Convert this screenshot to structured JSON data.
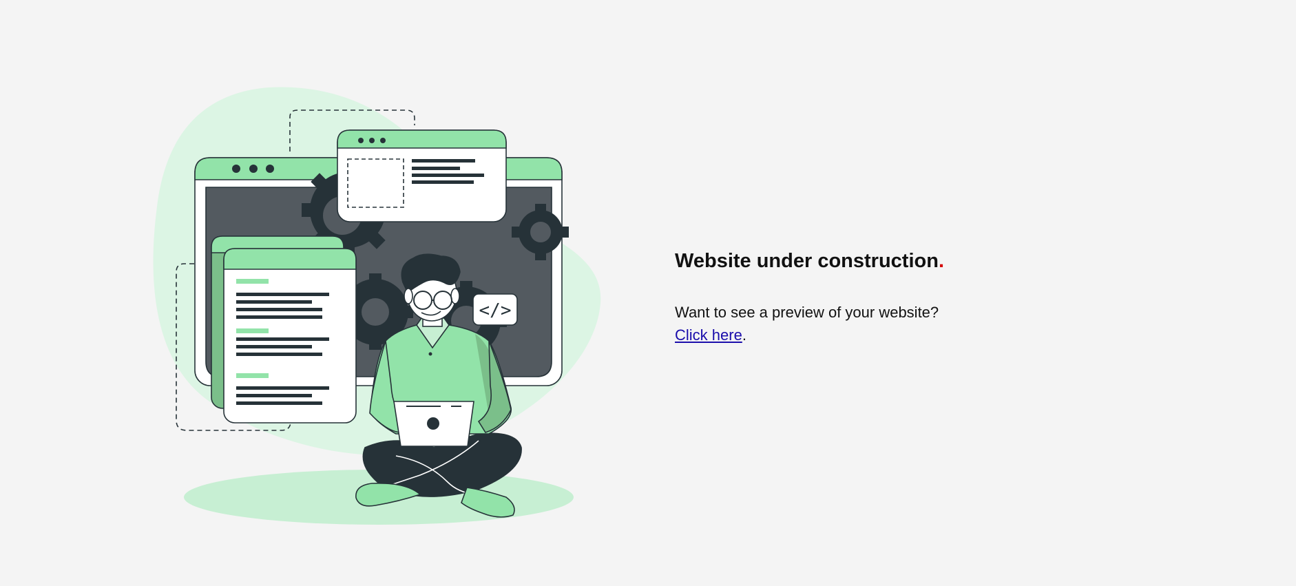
{
  "hero": {
    "headline": "Website under construction",
    "headline_dot": ".",
    "preview_text": "Want to see a preview of your website?",
    "link_text": "Click here",
    "link_suffix": ".",
    "code_badge": "</>"
  },
  "colors": {
    "background": "#f4f4f4",
    "accent_green": "#92e3a9",
    "dark": "#263238",
    "dot": "#d40000",
    "link": "#1a0dab"
  }
}
